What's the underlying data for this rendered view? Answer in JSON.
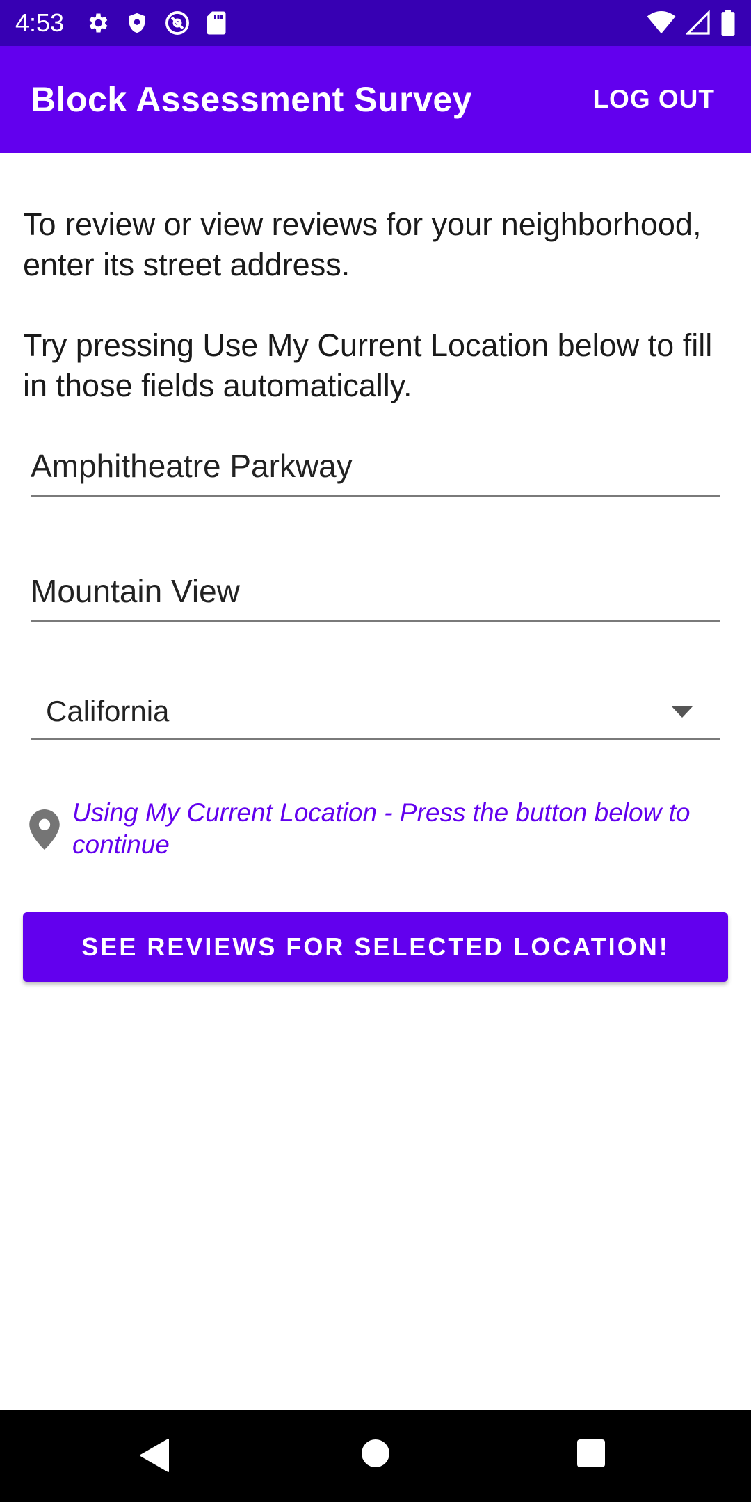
{
  "status_bar": {
    "time": "4:53",
    "left_icons": [
      "settings-icon",
      "shield-icon",
      "at-sign-icon",
      "sd-card-icon"
    ],
    "right_icons": [
      "wifi-icon",
      "cell-signal-icon",
      "battery-icon"
    ]
  },
  "app_bar": {
    "title": "Block Assessment Survey",
    "logout_label": "LOG OUT",
    "color": "#6200ee"
  },
  "instructions": {
    "line1": "To review or view reviews for your neighborhood, enter its street address.",
    "line2": "Try pressing Use My Current Location below to fill in those fields automatically."
  },
  "form": {
    "street_value": "Amphitheatre Parkway",
    "city_value": "Mountain View",
    "state_selected": "California"
  },
  "location_status": {
    "icon": "location-pin-icon",
    "text": "Using My Current Location - Press the button below to continue"
  },
  "primary_button": {
    "label": "SEE REVIEWS FOR SELECTED LOCATION!"
  },
  "nav_bar": {
    "buttons": [
      "back-icon",
      "home-icon",
      "recent-apps-icon"
    ]
  }
}
